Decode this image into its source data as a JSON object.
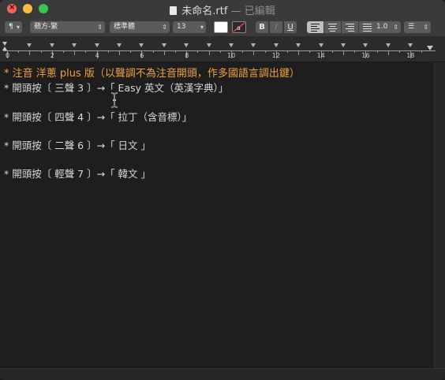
{
  "window": {
    "title": "未命名.rtf",
    "title_sep": " — ",
    "title_status": "已編輯"
  },
  "toolbar": {
    "paragraph_style": "¶",
    "font_family": "蘋方-繁",
    "typeface": "標準體",
    "font_size": "13",
    "bold_label": "B",
    "italic_label": "I",
    "underline_label": "U",
    "line_spacing": "1.0",
    "list_label": "☰"
  },
  "ruler": {
    "numbers": [
      "0",
      "2",
      "4",
      "6",
      "8",
      "10",
      "12",
      "14",
      "16",
      "18"
    ]
  },
  "document": {
    "lines": [
      "* 注音 洋蔥 plus 版（以聲調不為注音開頭，作多國語言調出鍵）",
      "* 開頭按〔 三聲 3 〕→「 Easy 英文（英漢字典）」",
      "* 開頭按〔 四聲 4 〕→「 拉丁（含音標）」",
      "* 開頭按〔 二聲 6 〕→「 日文 」",
      "* 開頭按〔 輕聲 7 〕→「 韓文 」"
    ]
  },
  "colors": {
    "heading": "#f0a040",
    "text": "#d8d8d8",
    "background": "#1e1e1e",
    "close": "#fc605c",
    "minimize": "#fdbc40",
    "maximize": "#34c84a"
  }
}
